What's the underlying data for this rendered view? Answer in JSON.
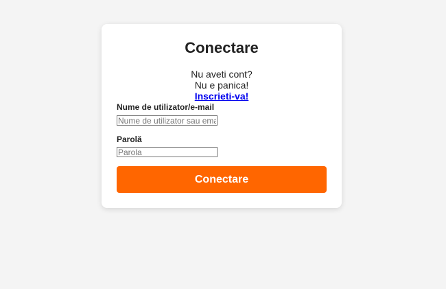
{
  "login": {
    "title": "Conectare",
    "no_account_line": "Nu aveti cont?",
    "no_panic_line": "Nu e panica!",
    "signup_link": "Inscrieti-va!",
    "username_label": "Nume de utilizator/e-mail",
    "username_placeholder": "Nume de utilizator sau email",
    "username_value": "",
    "password_label": "Parolă",
    "password_placeholder": "Parola",
    "password_value": "",
    "submit_label": "Conectare"
  },
  "colors": {
    "background": "#f4f4f4",
    "card": "#ffffff",
    "accent": "#ff6600",
    "link": "#0000ee"
  }
}
